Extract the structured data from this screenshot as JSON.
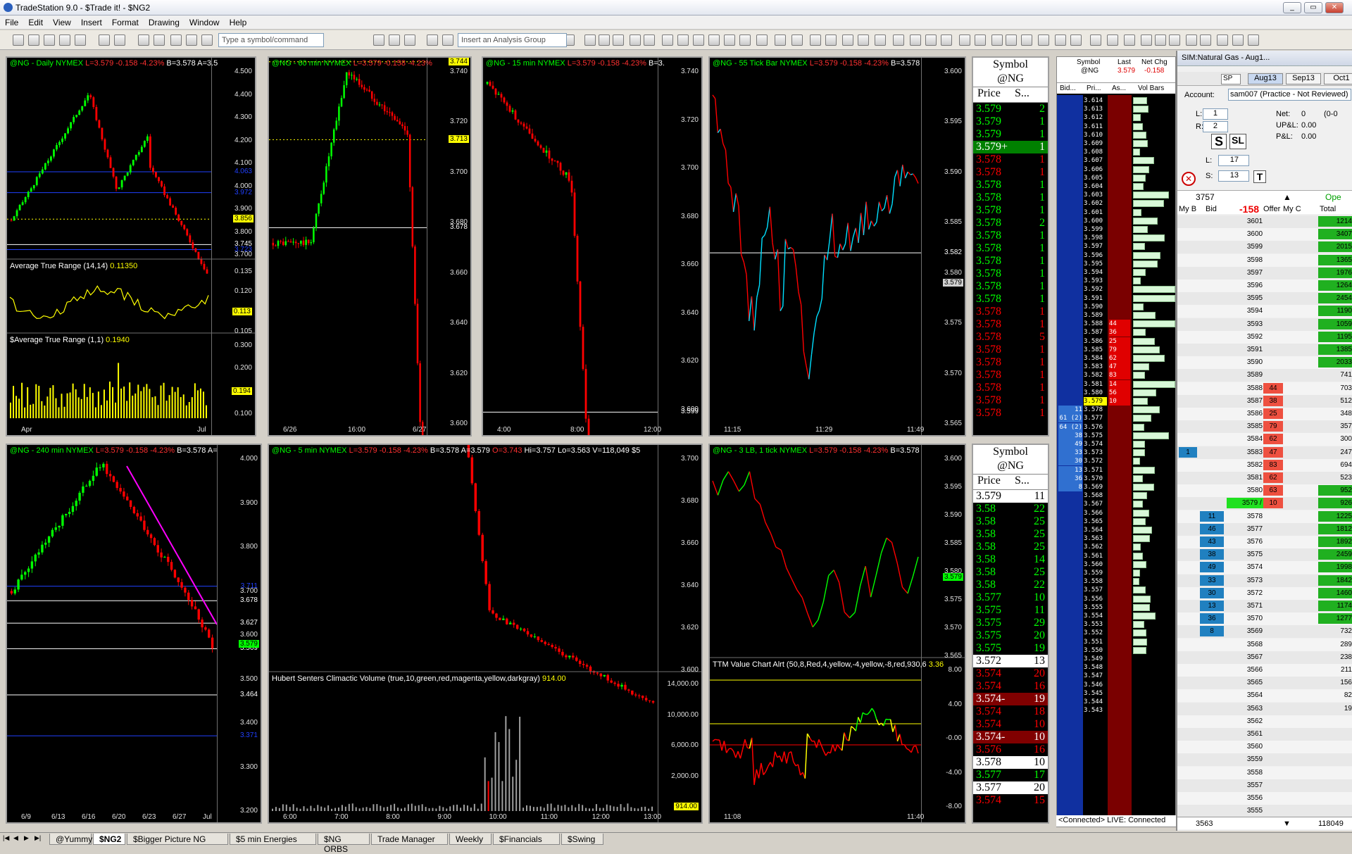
{
  "window": {
    "title": "TradeStation 9.0 - $Trade it! - $NG2"
  },
  "menu": [
    "File",
    "Edit",
    "View",
    "Insert",
    "Format",
    "Drawing",
    "Window",
    "Help"
  ],
  "toolbar": {
    "symbol_placeholder": "Type a symbol/command",
    "analysis_placeholder": "Insert an Analysis Group"
  },
  "charts": [
    {
      "id": "daily",
      "header": "@NG - Daily  NYMEX",
      "last": "L=3.579",
      "chg": "-0.158",
      "pct": "-4.23%",
      "bid": "B=3.578",
      "ask": "A=3.5",
      "ticks": [
        "4.500",
        "4.400",
        "4.300",
        "4.200",
        "4.100",
        "4.000",
        "3.900",
        "3.800",
        "3.700"
      ],
      "labels": [
        {
          "t": "3.856",
          "c": "#ffff00"
        },
        {
          "t": "3.745",
          "c": "#ffffff"
        },
        {
          "t": "3.579",
          "c": "#ff2020"
        },
        {
          "t": "4.063",
          "c": "#2040ff"
        },
        {
          "t": "3.972",
          "c": "#2040ff"
        },
        {
          "t": "3.723",
          "c": "#2040ff"
        },
        {
          "t": "3.647",
          "c": "#2040ff"
        }
      ],
      "ind1": {
        "name": "Average True Range (14,14)",
        "value": "0.11350",
        "ticks": [
          "0.135",
          "0.120",
          "0.113",
          "0.105"
        ]
      },
      "ind2": {
        "name": "$Average True Range (1,1)",
        "value": "0.1940",
        "ticks": [
          "0.300",
          "0.200",
          "0.194",
          "0.100"
        ]
      },
      "xlabels": [
        "Apr",
        "Jul"
      ]
    },
    {
      "id": "min60",
      "header": "@NG - 60 min  NYMEX",
      "last": "L=3.579",
      "chg": "-0.158",
      "pct": "-4.23%",
      "ticks": [
        "3.740",
        "3.720",
        "3.700",
        "3.680",
        "3.660",
        "3.640",
        "3.620",
        "3.600"
      ],
      "labels": [
        {
          "t": "3.744",
          "c": "#ffff00"
        },
        {
          "t": "3.713",
          "c": "#ffff00"
        },
        {
          "t": "3.678",
          "c": "#ffffff"
        },
        {
          "t": "3.579",
          "c": "#00ff00"
        }
      ],
      "xlabels": [
        "6/26",
        "16:00",
        "6/27"
      ]
    },
    {
      "id": "min15",
      "header": "@NG - 15 min  NYMEX",
      "last": "L=3.579",
      "chg": "-0.158",
      "pct": "-4.23%",
      "bid": "B=3.",
      "ticks": [
        "3.740",
        "3.720",
        "3.700",
        "3.680",
        "3.660",
        "3.640",
        "3.620",
        "3.600"
      ],
      "labels": [
        {
          "t": "3.599",
          "c": "#ffffff"
        },
        {
          "t": "3.582",
          "c": "#ffffff"
        },
        {
          "t": "3.579",
          "c": "#00ff00"
        },
        {
          "t": "3.570",
          "c": "#ffffff"
        }
      ],
      "xlabels": [
        "4:00",
        "8:00",
        "12:00"
      ]
    },
    {
      "id": "tick55",
      "header": "@NG - 55 Tick Bar  NYMEX",
      "last": "L=3.579",
      "chg": "-0.158",
      "pct": "-4.23%",
      "bid": "B=3.578",
      "ticks": [
        "3.600",
        "3.595",
        "3.590",
        "3.585",
        "3.580",
        "3.575",
        "3.570",
        "3.565"
      ],
      "labels": [
        {
          "t": "3.582",
          "c": "#ffffff"
        },
        {
          "t": "3.579",
          "c": "#d0d0d0"
        }
      ],
      "xlabels": [
        "11:15",
        "11:29",
        "11:49"
      ]
    },
    {
      "id": "min240",
      "header": "@NG - 240 min  NYMEX",
      "last": "L=3.579",
      "chg": "-0.158",
      "pct": "-4.23%",
      "bid": "B=3.578",
      "ask": "A=",
      "ticks": [
        "4.000",
        "3.900",
        "3.800",
        "3.700",
        "3.600",
        "3.500",
        "3.400",
        "3.300",
        "3.200"
      ],
      "labels": [
        {
          "t": "3.711",
          "c": "#2040ff"
        },
        {
          "t": "3.678",
          "c": "#ffffff"
        },
        {
          "t": "3.627",
          "c": "#ffffff"
        },
        {
          "t": "3.569",
          "c": "#ffffff"
        },
        {
          "t": "3.579",
          "c": "#00ff00"
        },
        {
          "t": "3.464",
          "c": "#ffffff"
        },
        {
          "t": "3.371",
          "c": "#2040ff"
        }
      ],
      "xlabels": [
        "6/9",
        "6/13",
        "6/16",
        "6/20",
        "6/23",
        "6/27",
        "Jul"
      ]
    },
    {
      "id": "min5",
      "header": "@NG - 5 min  NYMEX",
      "last": "L=3.579",
      "chg": "-0.158",
      "pct": "-4.23%",
      "bid": "B=3.578",
      "ask": "A=3.579",
      "open": "O=3.743",
      "hi": "Hi=3.757",
      "lo": "Lo=3.563",
      "vol": "V=118,049",
      "extra": "$5",
      "ticks": [
        "3.700",
        "3.680",
        "3.660",
        "3.640",
        "3.620",
        "3.600"
      ],
      "labels": [
        {
          "t": "3.729",
          "c": "#ff40ff"
        },
        {
          "t": "3.720",
          "c": "#ffffff"
        },
        {
          "t": "3.713",
          "c": "#ffff00"
        },
        {
          "t": "3.579",
          "c": "#00ff00"
        }
      ],
      "ind1": {
        "name": "Hubert Senters Climactic Volume (true,10,green,red,magenta,yellow,darkgray)",
        "value": "914.00",
        "ticks": [
          "14,000.00",
          "10,000.00",
          "6,000.00",
          "2,000.00",
          "914.00"
        ]
      },
      "xlabels": [
        "6:00",
        "7:00",
        "8:00",
        "9:00",
        "10:00",
        "11:00",
        "12:00",
        "13:00"
      ]
    },
    {
      "id": "lb3",
      "header": "@NG - 3 LB, 1 tick  NYMEX",
      "last": "L=3.579",
      "chg": "-0.158",
      "pct": "-4.23%",
      "bid": "B=3.578",
      "ticks": [
        "3.600",
        "3.595",
        "3.590",
        "3.585",
        "3.580",
        "3.575",
        "3.570",
        "3.565"
      ],
      "labels": [
        {
          "t": "3.579",
          "c": "#00ff00"
        }
      ],
      "ind1": {
        "name": "TTM Value Chart Alrt (50,8,Red,4,yellow,-4,yellow,-8,red,930,6",
        "value": "3.36",
        "ticks": [
          "8.00",
          "4.00",
          "-0.00",
          "-4.00",
          "-8.00"
        ]
      },
      "xlabels": [
        "11:08",
        "11:40"
      ]
    }
  ],
  "ts_top": {
    "symbol_label": "Symbol",
    "symbol": "@NG",
    "col1": "Price",
    "col2": "S...",
    "rows": [
      [
        "3.579",
        "2",
        "g"
      ],
      [
        "3.579",
        "1",
        "g"
      ],
      [
        "3.579",
        "1",
        "g"
      ],
      [
        "3.579+",
        "1",
        "gw"
      ],
      [
        "3.578",
        "1",
        "r"
      ],
      [
        "3.578",
        "1",
        "r"
      ],
      [
        "3.578",
        "1",
        "g"
      ],
      [
        "3.578",
        "1",
        "g"
      ],
      [
        "3.578",
        "1",
        "g"
      ],
      [
        "3.578",
        "2",
        "g"
      ],
      [
        "3.578",
        "1",
        "g"
      ],
      [
        "3.578",
        "1",
        "g"
      ],
      [
        "3.578",
        "1",
        "g"
      ],
      [
        "3.578",
        "1",
        "g"
      ],
      [
        "3.578",
        "1",
        "g"
      ],
      [
        "3.578",
        "1",
        "g"
      ],
      [
        "3.578",
        "1",
        "r"
      ],
      [
        "3.578",
        "1",
        "r"
      ],
      [
        "3.578",
        "5",
        "r"
      ],
      [
        "3.578",
        "1",
        "r"
      ],
      [
        "3.578",
        "1",
        "r"
      ],
      [
        "3.578",
        "1",
        "r"
      ],
      [
        "3.578",
        "1",
        "r"
      ],
      [
        "3.578",
        "1",
        "r"
      ],
      [
        "3.578",
        "1",
        "r"
      ]
    ]
  },
  "ts_bottom": {
    "symbol_label": "Symbol",
    "symbol": "@NG",
    "col1": "Price",
    "col2": "S...",
    "rows": [
      [
        "3.579",
        "11",
        "w"
      ],
      [
        "3.58",
        "22",
        "g"
      ],
      [
        "3.58",
        "25",
        "g"
      ],
      [
        "3.58",
        "25",
        "g"
      ],
      [
        "3.58",
        "25",
        "g"
      ],
      [
        "3.58",
        "14",
        "g"
      ],
      [
        "3.58",
        "25",
        "g"
      ],
      [
        "3.58",
        "22",
        "g"
      ],
      [
        "3.577",
        "10",
        "g"
      ],
      [
        "3.575",
        "11",
        "g"
      ],
      [
        "3.575",
        "29",
        "g"
      ],
      [
        "3.575",
        "20",
        "g"
      ],
      [
        "3.575",
        "19",
        "g"
      ],
      [
        "3.572",
        "13",
        "w"
      ],
      [
        "3.574",
        "20",
        "r"
      ],
      [
        "3.574",
        "16",
        "r"
      ],
      [
        "3.574-",
        "19",
        "rw"
      ],
      [
        "3.574",
        "18",
        "r"
      ],
      [
        "3.574",
        "10",
        "r"
      ],
      [
        "3.574-",
        "10",
        "rw"
      ],
      [
        "3.576",
        "16",
        "r"
      ],
      [
        "3.578",
        "10",
        "w"
      ],
      [
        "3.577",
        "17",
        "g"
      ],
      [
        "3.577",
        "20",
        "w"
      ],
      [
        "3.574",
        "15",
        "r"
      ]
    ]
  },
  "market_depth": {
    "headers": [
      "Symbol",
      "Last",
      "Net Chg"
    ],
    "symbol": "@NG",
    "last": "3.579",
    "net": "-0.158",
    "cols": [
      "Bid...",
      "Pri...",
      "As...",
      "Vol Bars"
    ],
    "prices": [
      "3.614",
      "3.613",
      "3.612",
      "3.611",
      "3.610",
      "3.609",
      "3.608",
      "3.607",
      "3.606",
      "3.605",
      "3.604",
      "3.603",
      "3.602",
      "3.601",
      "3.600",
      "3.599",
      "3.598",
      "3.597",
      "3.596",
      "3.595",
      "3.594",
      "3.593",
      "3.592",
      "3.591",
      "3.590",
      "3.589",
      "3.588",
      "3.587",
      "3.586",
      "3.585",
      "3.584",
      "3.583",
      "3.582",
      "3.581",
      "3.580",
      "3.579",
      "3.578",
      "3.577",
      "3.576",
      "3.575",
      "3.574",
      "3.573",
      "3.572",
      "3.571",
      "3.570",
      "3.569",
      "3.568",
      "3.567",
      "3.566",
      "3.565",
      "3.564",
      "3.563",
      "3.562",
      "3.561",
      "3.560",
      "3.559",
      "3.558",
      "3.557",
      "3.556",
      "3.555",
      "3.554",
      "3.553",
      "3.552",
      "3.551",
      "3.550",
      "3.549",
      "3.548",
      "3.547",
      "3.546",
      "3.545",
      "3.544",
      "3.543"
    ],
    "asks": {
      "3.588": "44",
      "3.587": "36",
      "3.586": "25",
      "3.585": "79",
      "3.584": "62",
      "3.583": "47",
      "3.582": "83",
      "3.581": "14 (2)",
      "3.580": "56 (2)",
      "3.579": "10"
    },
    "bids": {
      "3.578": "11",
      "3.577": "61 (2)",
      "3.576": "64 (2)",
      "3.575": "38",
      "3.574": "49",
      "3.573": "33",
      "3.572": "30",
      "3.571": "13",
      "3.570": "36",
      "3.569": "8"
    },
    "status": "<Connected>  LIVE:  Connected"
  },
  "matrix": {
    "title": "SIM:Natural Gas - Aug1...",
    "sp": "SP",
    "months": [
      "Aug13",
      "Sep13",
      "Oct1"
    ],
    "account_label": "Account:",
    "account": "sam007 (Practice - Not Reviewed)",
    "l_label": "L:",
    "l_val": "1",
    "r_label": "R:",
    "r_val": "2",
    "net_label": "Net:",
    "net": "0",
    "net2": "(0-0",
    "upl_label": "UP&L:",
    "upl": "0.00",
    "pl_label": "P&L:",
    "pl": "0.00",
    "l2_label": "L:",
    "l2": "17",
    "s_label": "S:",
    "s2": "13",
    "t": "T",
    "top_val": "3757",
    "delta": "-158",
    "opn": "Ope",
    "col_heads": [
      "My B",
      "Bid",
      "Offer",
      "My C",
      "Total"
    ],
    "rows": [
      [
        "3601",
        "",
        "",
        ""
      ],
      [
        "3600",
        "",
        "",
        ""
      ],
      [
        "3599",
        "",
        "",
        ""
      ],
      [
        "3598",
        "",
        "",
        ""
      ],
      [
        "3597",
        "",
        "",
        ""
      ],
      [
        "3596",
        "",
        "",
        ""
      ],
      [
        "3595",
        "",
        "",
        ""
      ],
      [
        "3594",
        "",
        "",
        ""
      ],
      [
        "3593",
        "",
        "",
        ""
      ],
      [
        "3592",
        "",
        "",
        ""
      ],
      [
        "3591",
        "",
        "",
        ""
      ],
      [
        "3590",
        "",
        "",
        ""
      ],
      [
        "3589",
        "",
        "",
        ""
      ],
      [
        "3588",
        "",
        "44",
        ""
      ],
      [
        "3587",
        "",
        "38",
        ""
      ],
      [
        "3586",
        "",
        "25",
        ""
      ],
      [
        "3585",
        "",
        "79",
        ""
      ],
      [
        "3584",
        "",
        "62",
        ""
      ],
      [
        "3583",
        "",
        "47",
        "1"
      ],
      [
        "3582",
        "",
        "83",
        ""
      ],
      [
        "3581",
        "",
        "62",
        ""
      ],
      [
        "3580",
        "",
        "63",
        ""
      ],
      [
        "3579 / 5",
        "",
        "10",
        ""
      ],
      [
        "3578",
        "11",
        "",
        ""
      ],
      [
        "3577",
        "46",
        "",
        ""
      ],
      [
        "3576",
        "43",
        "",
        ""
      ],
      [
        "3575",
        "38",
        "",
        ""
      ],
      [
        "3574",
        "49",
        "",
        ""
      ],
      [
        "3573",
        "33",
        "",
        ""
      ],
      [
        "3572",
        "30",
        "",
        ""
      ],
      [
        "3571",
        "13",
        "",
        ""
      ],
      [
        "3570",
        "36",
        "",
        ""
      ],
      [
        "3569",
        "8",
        "",
        ""
      ],
      [
        "3568",
        "",
        "",
        ""
      ],
      [
        "3567",
        "",
        "",
        ""
      ],
      [
        "3566",
        "",
        "",
        ""
      ],
      [
        "3565",
        "",
        "",
        ""
      ],
      [
        "3564",
        "",
        "",
        ""
      ],
      [
        "3563",
        "",
        "",
        ""
      ],
      [
        "3562",
        "",
        "",
        ""
      ],
      [
        "3561",
        "",
        "",
        ""
      ],
      [
        "3560",
        "",
        "",
        ""
      ],
      [
        "3559",
        "",
        "",
        ""
      ],
      [
        "3558",
        "",
        "",
        ""
      ],
      [
        "3557",
        "",
        "",
        ""
      ],
      [
        "3556",
        "",
        "",
        ""
      ],
      [
        "3555",
        "",
        "",
        ""
      ]
    ],
    "totals": [
      "1214",
      "3407",
      "2015",
      "1365",
      "1976",
      "1264",
      "2454",
      "1190",
      "1059",
      "1195",
      "1385",
      "2033",
      "741",
      "703",
      "512",
      "348",
      "357",
      "300",
      "247",
      "694",
      "523",
      "952",
      "926",
      "1225",
      "1812",
      "1892",
      "2459",
      "1998",
      "1842",
      "1460",
      "1174",
      "1277",
      "732",
      "289",
      "238",
      "211",
      "156",
      "82",
      "19",
      "",
      "",
      "",
      "",
      "",
      "",
      "",
      ""
    ],
    "bottom_left": "3563",
    "bottom_right": "118049"
  },
  "tabs": [
    "@Yummy",
    "$NG2",
    "$Bigger Picture NG",
    "$5 min Energies",
    "$NG ORBS",
    "Trade Manager",
    "Weekly",
    "$Financials",
    "$Swing"
  ],
  "active_tab": 1,
  "colors": {
    "up": "#00ff00",
    "down": "#ff0000",
    "tick_up": "#00e0ff",
    "yellow": "#ffff00",
    "magenta": "#ff00ff",
    "blue": "#2040ff"
  }
}
